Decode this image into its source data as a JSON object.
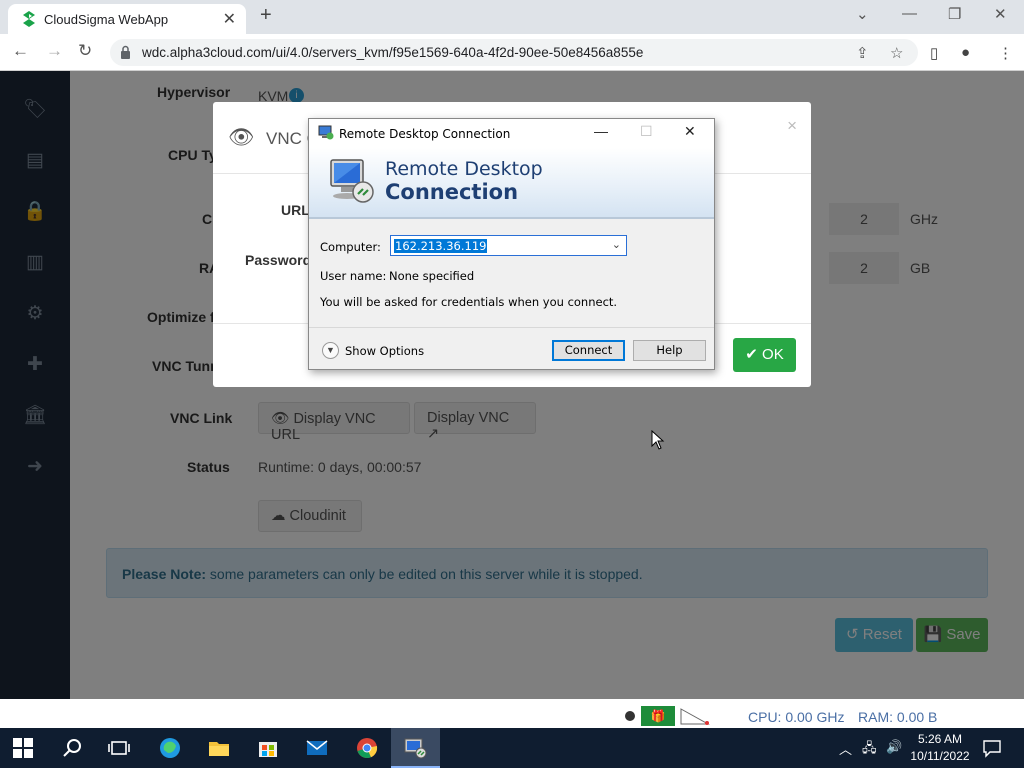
{
  "browser": {
    "tab_title": "CloudSigma WebApp",
    "url": "wdc.alpha3cloud.com/ui/4.0/servers_kvm/f95e1569-640a-4f2d-90ee-50e8456a855e"
  },
  "sidebar": {
    "items": [
      "tag-icon",
      "list-icon",
      "lock-icon",
      "bar-chart-icon",
      "gears-icon",
      "medkit-icon",
      "bank-icon",
      "logout-icon"
    ]
  },
  "server": {
    "hypervisor_label": "Hypervisor",
    "hypervisor_value": "KVM",
    "cpu_type_label": "CPU Ty",
    "cpu_label": "Cl",
    "cpu_value": "2",
    "cpu_unit": "GHz",
    "ram_label": "RA",
    "ram_value": "2",
    "ram_unit": "GB",
    "optimize_label": "Optimize f",
    "vnc_tunnel_label": "VNC Tunn",
    "vnc_link_label": "VNC Link",
    "display_vnc_url": "Display VNC URL",
    "display_vnc": "Display VNC",
    "status_label": "Status",
    "status_value": "Runtime: 0 days, 00:00:57",
    "cloudinit": "Cloudinit",
    "note_bold": "Please Note:",
    "note_text": " some parameters can only be edited on this server while it is stopped.",
    "reset": "Reset",
    "save": "Save"
  },
  "statusbar": {
    "cpu": "CPU: 0.00 GHz",
    "ram": "RAM: 0.00 B"
  },
  "vnc_modal": {
    "title": "VNC C",
    "url_label": "URL",
    "password_label": "Password",
    "ok": "OK"
  },
  "rdp": {
    "title": "Remote Desktop Connection",
    "heading_line1": "Remote Desktop",
    "heading_line2": "Connection",
    "computer_label": "Computer:",
    "computer_value": "162.213.36.119",
    "username_label": "User name:",
    "username_value": "None specified",
    "info": "You will be asked for credentials when you connect.",
    "show_options": "Show Options",
    "connect": "Connect",
    "help": "Help"
  },
  "taskbar": {
    "time": "5:26 AM",
    "date": "10/11/2022"
  },
  "colors": {
    "sidebar_bg": "#1c2838",
    "ok_green": "#28a745",
    "save_green": "#5cb85c",
    "reset_blue": "#5bc0de",
    "rdp_heading": "#1e3f73",
    "taskbar_bg": "#0f1d30"
  }
}
